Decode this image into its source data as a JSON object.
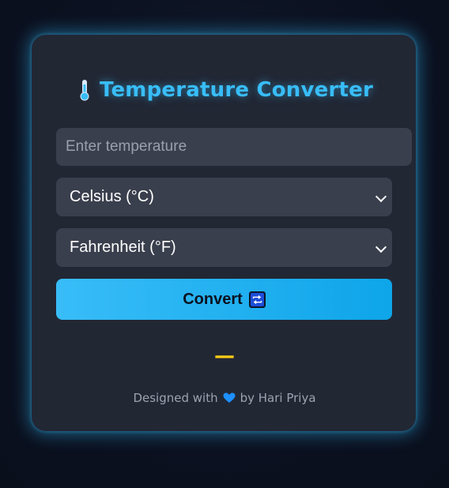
{
  "card": {
    "title": "Temperature Converter",
    "title_icon": "thermometer-icon"
  },
  "form": {
    "temperature_placeholder": "Enter temperature",
    "temperature_value": "",
    "from_unit": "Celsius (°C)",
    "to_unit": "Fahrenheit (°F)",
    "convert_label": "Convert",
    "convert_icon": "refresh-icon"
  },
  "result": {
    "text": "—"
  },
  "footer": {
    "prefix": "Designed with",
    "icon": "heart-icon",
    "suffix": "by Hari Priya"
  },
  "colors": {
    "accent": "#38bdf8",
    "card_bg": "#222734",
    "field_bg": "#3a3f4d",
    "result": "#facc15",
    "heart": "#1e90ff"
  }
}
